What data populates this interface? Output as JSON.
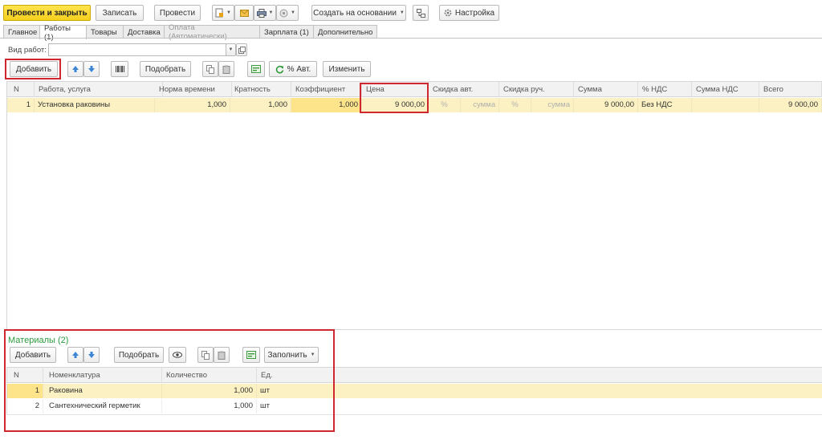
{
  "toolbar": {
    "post_close": "Провести и закрыть",
    "save": "Записать",
    "post": "Провести",
    "create_based": "Создать на основании",
    "settings": "Настройка"
  },
  "tabs": [
    {
      "label": "Главное"
    },
    {
      "label": "Работы (1)"
    },
    {
      "label": "Товары"
    },
    {
      "label": "Доставка"
    },
    {
      "label": "Оплата (Автоматически)"
    },
    {
      "label": "Зарплата (1)"
    },
    {
      "label": "Дополнительно"
    }
  ],
  "work_type": {
    "label": "Вид работ:",
    "value": ""
  },
  "works_toolbar": {
    "add": "Добавить",
    "pick": "Подобрать",
    "auto_pct": "% Авт.",
    "change": "Изменить"
  },
  "works_table": {
    "headers": [
      "N",
      "Работа, услуга",
      "Норма времени",
      "Кратность",
      "Коэффициент",
      "Цена",
      "Скидка авт.",
      "Скидка руч.",
      "Сумма",
      "% НДС",
      "Сумма НДС",
      "Всего"
    ],
    "rows": [
      {
        "n": "1",
        "work": "Установка раковины",
        "norm": "1,000",
        "mult": "1,000",
        "coef": "1,000",
        "price": "9 000,00",
        "disc_auto_pct": "%",
        "disc_auto_sum": "сумма",
        "disc_man_pct": "%",
        "disc_man_sum": "сумма",
        "sum": "9 000,00",
        "vat_pct": "Без НДС",
        "vat_sum": "",
        "total": "9 000,00"
      }
    ]
  },
  "materials": {
    "title": "Материалы (2)",
    "add": "Добавить",
    "pick": "Подобрать",
    "fill": "Заполнить",
    "headers": [
      "N",
      "Номенклатура",
      "Количество",
      "Ед."
    ],
    "rows": [
      {
        "n": "1",
        "name": "Раковина",
        "qty": "1,000",
        "unit": "шт"
      },
      {
        "n": "2",
        "name": "Сантехнический герметик",
        "qty": "1,000",
        "unit": "шт"
      }
    ]
  },
  "colors": {
    "accent_yellow": "#f5cf1e",
    "highlight_red": "#d0262e",
    "section_green": "#2b9a3c",
    "row_selected": "#fbf1c2"
  }
}
